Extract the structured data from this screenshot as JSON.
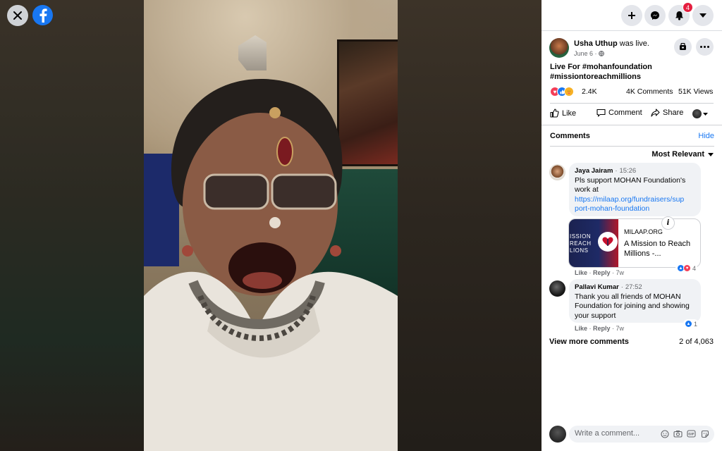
{
  "viewer": {
    "close_icon": "close-icon",
    "logo_icon": "facebook-logo-icon"
  },
  "topbar": {
    "create_icon": "plus-icon",
    "messenger_icon": "messenger-icon",
    "notifications_icon": "bell-icon",
    "notifications_badge": "4",
    "account_icon": "caret-down-icon"
  },
  "post": {
    "author": "Usha Uthup",
    "action": " was live.",
    "date": "June 6",
    "privacy_icon": "globe-icon",
    "caption_line1": "Live For #mohanfoundation",
    "caption_line2": "#missiontoreachmillions",
    "reactions_count": "2.4K",
    "comments_count": "4K Comments",
    "views_count": "51K Views",
    "like_label": "Like",
    "comment_label": "Comment",
    "share_label": "Share"
  },
  "comments_section": {
    "title": "Comments",
    "hide_label": "Hide",
    "sort_label": "Most Relevant",
    "view_more": "View more comments",
    "count": "2 of 4,063",
    "items": [
      {
        "name": "Jaya Jairam",
        "time": "15:26",
        "text": "Pls support MOHAN Foundation's work at",
        "link_line1": "https://milaap.org/fundraisers/sup",
        "link_line2": "port-mohan-foundation",
        "like": "Like",
        "reply": "Reply",
        "age": "7w",
        "reactions": "4"
      },
      {
        "name": "Pallavi Kumar",
        "time": "27:52",
        "text_line1": "Thank you all friends of MOHAN",
        "text_line2": "Foundation for joining and showing",
        "text_line3": "your support",
        "like": "Like",
        "reply": "Reply",
        "age": "7w",
        "reactions": "1"
      }
    ],
    "link_card": {
      "image_text_1": "ISSION",
      "image_text_2": "REACH",
      "image_text_3": "LIONS",
      "site": "MILAAP.ORG",
      "title": "A Mission to Reach Millions -..."
    }
  },
  "composer": {
    "placeholder": "Write a comment..."
  },
  "colors": {
    "accent": "#1877f2",
    "badge": "#e41e3f",
    "bubble": "#f0f2f5"
  }
}
